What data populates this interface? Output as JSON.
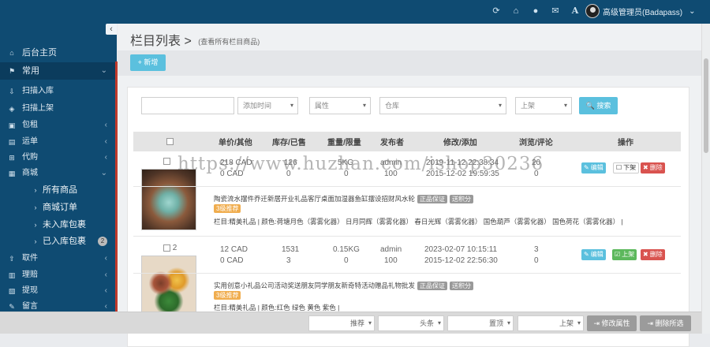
{
  "topbar": {
    "icons": [
      "refresh-icon",
      "home-icon",
      "user-icon",
      "mail-icon",
      "font-icon"
    ],
    "user_name": "高级管理员(Badapass)",
    "user_caret": "⌄"
  },
  "sidebar": {
    "collapse_glyph": "‹",
    "home": "后台主页",
    "group": "常用",
    "items": [
      {
        "label": "扫描入库",
        "icon": "scan-in-icon",
        "arrow": false
      },
      {
        "label": "扫描上架",
        "icon": "tag-icon",
        "arrow": false
      },
      {
        "label": "包租",
        "icon": "box-icon",
        "arrow": true
      },
      {
        "label": "运单",
        "icon": "truck-icon",
        "arrow": true
      },
      {
        "label": "代购",
        "icon": "cart-icon",
        "arrow": true
      },
      {
        "label": "商城",
        "icon": "shop-icon",
        "arrow": true
      }
    ],
    "sub_items": [
      {
        "label": "所有商品",
        "badge": ""
      },
      {
        "label": "商城订单",
        "badge": ""
      },
      {
        "label": "未入库包裹",
        "badge": ""
      },
      {
        "label": "已入库包裹",
        "badge": "2"
      }
    ],
    "bottom_items": [
      {
        "label": "取件",
        "icon": "pickup-icon"
      },
      {
        "label": "理赔",
        "icon": "claim-icon"
      },
      {
        "label": "提现",
        "icon": "withdraw-icon"
      },
      {
        "label": "留言",
        "icon": "message-icon"
      }
    ]
  },
  "page": {
    "title": "栏目列表 >",
    "subtitle": "(查看所有栏目商品)",
    "add_button": "+ 新增"
  },
  "filters": {
    "keyword_placeholder": "",
    "time_placeholder": "添加时间",
    "attr": "属性",
    "warehouse": "仓库",
    "shelf": "上架",
    "search_button": "🔍 搜索"
  },
  "table": {
    "headers": [
      "",
      "单价/其他",
      "库存/已售",
      "重量/限量",
      "发布者",
      "修改/添加",
      "浏览/评论",
      "操作"
    ],
    "rows": [
      {
        "index": "",
        "price": "218 CAD",
        "price2": "0 CAD",
        "stock": "126",
        "sold": "0",
        "weight": "5KG",
        "limit": "0",
        "publisher": "admin",
        "publisher2": "100",
        "modified": "2019-11-12 22:38:34",
        "added": "2015-12-02 19:59:35",
        "views": "20",
        "comments": "0",
        "shelf_action": "下架",
        "title": "陶瓷流水摆件乔迁新居开业礼品客厅桌面加湿器鱼缸摆设招财风水轮",
        "tags": [
          "正品保证",
          "送积分"
        ],
        "promo": "3级推荐",
        "attrs": "栏目:精美礼品 | 颜色:荷塘月色（雾雾化器） 日月同辉（雾雾化器） 春日光辉（雾雾化器） 国色葫芦（雾雾化器） 国色荷花（雾雾化器） |"
      },
      {
        "index": "2",
        "price": "12 CAD",
        "price2": "0 CAD",
        "stock": "1531",
        "sold": "3",
        "weight": "0.15KG",
        "limit": "0",
        "publisher": "admin",
        "publisher2": "100",
        "modified": "2023-02-07 10:15:11",
        "added": "2015-12-02 22:56:30",
        "views": "3",
        "comments": "0",
        "shelf_action": "上架",
        "title": "实用创意小礼品公司活动奖送朋友同学朋友新奇特活动赠品礼物批发",
        "tags": [
          "正品保证",
          "送积分"
        ],
        "promo": "3级推荐",
        "attrs": "栏目:精美礼品 | 颜色:红色 绿色 黄色 紫色 |"
      }
    ],
    "edit_label": "编辑",
    "delete_label": "删除"
  },
  "bottom_bar": {
    "recommend": "推荐",
    "headline": "头条",
    "top": "置顶",
    "shelf": "上架",
    "modify_attr": "修改属性",
    "delete_selected": "删除所选"
  },
  "watermark": "https://www.huzhan.com/ishop30236",
  "colors": {
    "sidebar_bg": "#0f4b72",
    "accent_info": "#5bc0de",
    "danger": "#d9534f",
    "success": "#5cb85c",
    "tag_orange": "#f0ad4e"
  }
}
